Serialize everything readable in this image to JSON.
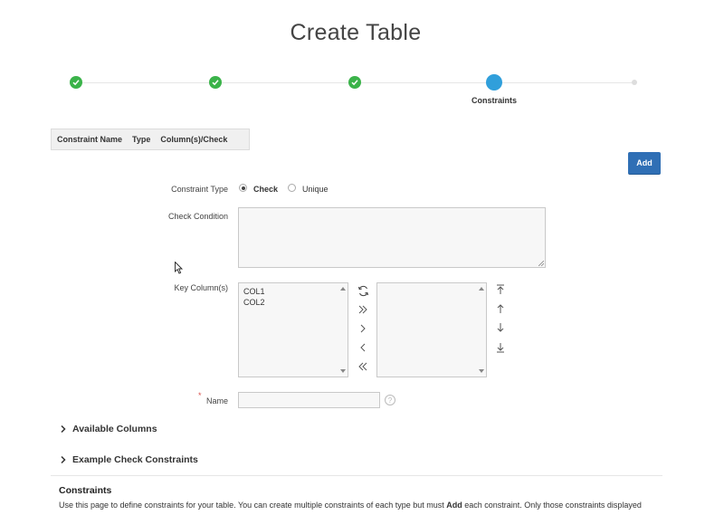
{
  "page": {
    "title": "Create Table"
  },
  "wizard": {
    "current_step_label": "Constraints",
    "steps": [
      "complete",
      "complete",
      "complete",
      "current",
      "pending"
    ]
  },
  "report": {
    "columns": [
      "Constraint Name",
      "Type",
      "Column(s)/Check"
    ]
  },
  "toolbar": {
    "add_label": "Add"
  },
  "form": {
    "constraint_type_label": "Constraint Type",
    "constraint_type_options": [
      "Check",
      "Unique"
    ],
    "constraint_type_selected": "Check",
    "check_condition_label": "Check Condition",
    "key_columns_label": "Key Column(s)",
    "available_columns": [
      "COL1",
      "COL2"
    ],
    "selected_columns": [],
    "name_label": "Name",
    "name_required_marker": "*",
    "help_icon": "?"
  },
  "regions": {
    "available_columns_title": "Available Columns",
    "example_check_title": "Example Check Constraints"
  },
  "help": {
    "title": "Constraints",
    "text_before": "Use this page to define constraints for your table. You can create multiple constraints of each type but must ",
    "text_bold": "Add",
    "text_after": " each constraint. Only those constraints displayed"
  },
  "colors": {
    "accent": "#309fdb",
    "complete": "#3bb34a",
    "button": "#2f6fb5"
  }
}
